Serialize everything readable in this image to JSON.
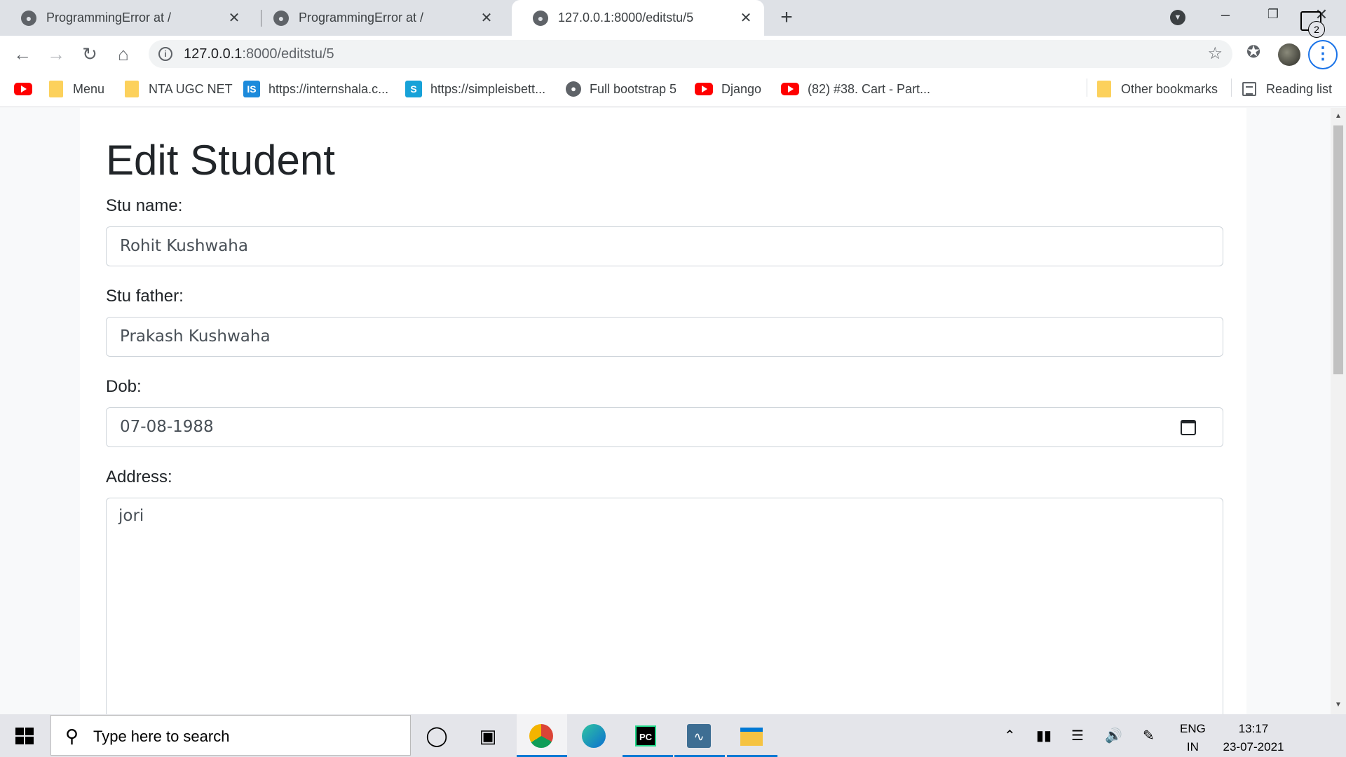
{
  "browser": {
    "tabs": [
      {
        "title": "ProgrammingError at /",
        "active": false
      },
      {
        "title": "ProgrammingError at /",
        "active": false
      },
      {
        "title": "127.0.0.1:8000/editstu/5",
        "active": true
      }
    ],
    "address": {
      "host": "127.0.0.1",
      "path": ":8000/editstu/5"
    },
    "bookmarks": [
      {
        "label": "",
        "icon": "youtube-icon"
      },
      {
        "label": "Menu",
        "icon": "folder-icon"
      },
      {
        "label": "NTA UGC NET",
        "icon": "folder-icon"
      },
      {
        "label": "https://internshala.c...",
        "icon": "internshala-icon"
      },
      {
        "label": "https://simpleisbett...",
        "icon": "simpleisbetter-icon"
      },
      {
        "label": "Full bootstrap 5",
        "icon": "globe-icon"
      },
      {
        "label": "Django",
        "icon": "youtube-icon"
      },
      {
        "label": "(82) #38. Cart - Part...",
        "icon": "youtube-icon"
      }
    ],
    "other_bookmarks": "Other bookmarks",
    "reading_list": "Reading list",
    "colors": {
      "tabstrip": "#dee1e6",
      "accent": "#1a73e8"
    }
  },
  "page": {
    "title": "Edit Student",
    "fields": {
      "name": {
        "label": "Stu name:",
        "value": "Rohit Kushwaha"
      },
      "father": {
        "label": "Stu father:",
        "value": "Prakash Kushwaha"
      },
      "dob": {
        "label": "Dob:",
        "value": "07-08-1988"
      },
      "address": {
        "label": "Address:",
        "value": "jori"
      }
    }
  },
  "taskbar": {
    "search_placeholder": "Type here to search",
    "lang": {
      "line1": "ENG",
      "line2": "IN"
    },
    "time": "13:17",
    "date": "23-07-2021",
    "notifications": "2"
  }
}
